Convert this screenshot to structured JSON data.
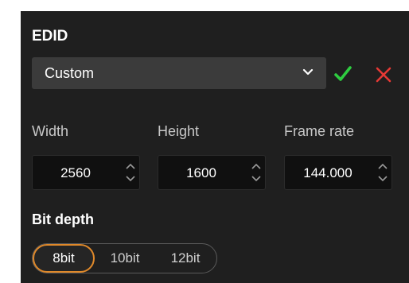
{
  "edid": {
    "title": "EDID",
    "preset": {
      "selected": "Custom"
    },
    "confirm_icon": "check-icon",
    "cancel_icon": "close-icon",
    "fields": [
      {
        "label": "Width",
        "value": "2560"
      },
      {
        "label": "Height",
        "value": "1600"
      },
      {
        "label": "Frame rate",
        "value": "144.000"
      }
    ],
    "bit_depth": {
      "label": "Bit depth",
      "options": [
        "8bit",
        "10bit",
        "12bit"
      ],
      "selected": "8bit"
    }
  },
  "colors": {
    "panel_bg": "#1f1f1f",
    "confirm": "#2ecc40",
    "cancel": "#e53935",
    "accent": "#e0892a"
  }
}
